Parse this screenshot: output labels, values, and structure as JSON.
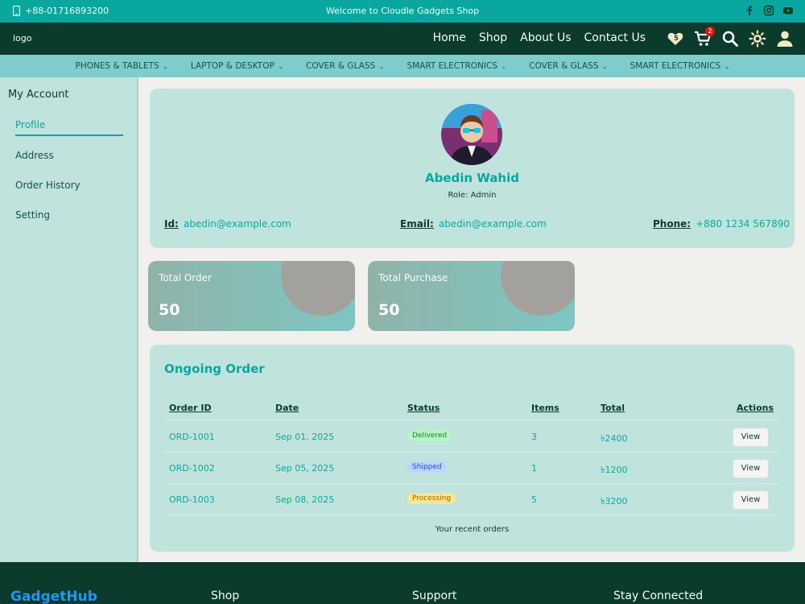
{
  "topbar": {
    "phone": "+88-01716893200",
    "welcome": "Welcome to Cloudle Gadgets Shop",
    "socials": [
      "facebook-icon",
      "instagram-icon",
      "youtube-icon"
    ]
  },
  "nav": {
    "logo": "logo",
    "links": [
      "Home",
      "Shop",
      "About Us",
      "Contact Us"
    ],
    "wishlist_count": "5",
    "cart_count": "2"
  },
  "categories": [
    "PHONES & TABLETS",
    "LAPTOP & DESKTOP",
    "COVER & GLASS",
    "SMART ELECTRONICS",
    "COVER & GLASS",
    "SMART ELECTRONICS"
  ],
  "sidebar": {
    "title": "My Account",
    "items": [
      "Profile",
      "Address",
      "Order History",
      "Setting"
    ],
    "active": "Profile"
  },
  "profile": {
    "name": "Abedin Wahid",
    "role": "Role: Admin",
    "id_label": "Id:",
    "id_value": "abedin@example.com",
    "email_label": "Email:",
    "email_value": "abedin@example.com",
    "phone_label": "Phone:",
    "phone_value": "+880 1234 567890"
  },
  "stats": [
    {
      "label": "Total Order",
      "value": "50"
    },
    {
      "label": "Total Purchase",
      "value": "50"
    }
  ],
  "orders": {
    "title": "Ongoing Order",
    "columns": [
      "Order ID",
      "Date",
      "Status",
      "Items",
      "Total",
      "Actions"
    ],
    "rows": [
      {
        "id": "ORD-1001",
        "date": "Sep 01, 2025",
        "status": "Delivered",
        "items": "3",
        "total": "৳2400",
        "action": "View"
      },
      {
        "id": "ORD-1002",
        "date": "Sep 05, 2025",
        "status": "Shipped",
        "items": "1",
        "total": "৳1200",
        "action": "View"
      },
      {
        "id": "ORD-1003",
        "date": "Sep 08, 2025",
        "status": "Processing",
        "items": "5",
        "total": "৳3200",
        "action": "View"
      }
    ],
    "caption": "Your recent orders"
  },
  "footer": {
    "brand": "GadgetHub",
    "columns": [
      "Shop",
      "Support",
      "Stay Connected"
    ]
  },
  "colors": {
    "accent": "#0aa7a0",
    "dark": "#0b3b2c",
    "card": "#c1e3de",
    "delivered": "#b9f5c4",
    "shipped": "#bcd4ff",
    "processing": "#fde68a"
  }
}
